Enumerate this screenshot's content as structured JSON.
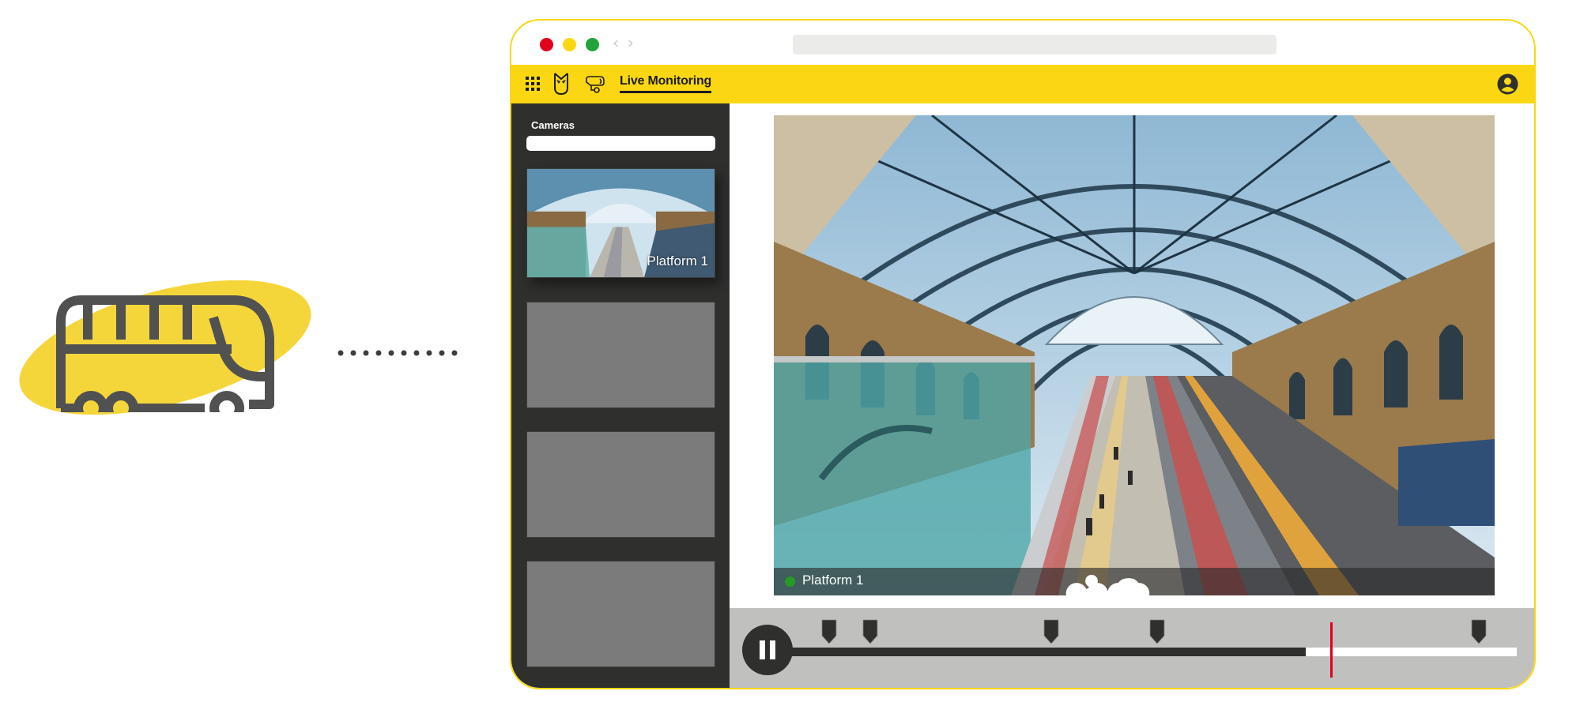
{
  "illustration": {
    "icon": "bus-icon",
    "connector": "dotted-line",
    "blob_color": "#f5d63a",
    "icon_color": "#515151"
  },
  "browser": {
    "traffic_lights": [
      "close",
      "minimize",
      "maximize"
    ],
    "nav_back": "‹",
    "nav_forward": "›",
    "address_bar_value": "",
    "frame_color": "#fbd713"
  },
  "appbar": {
    "apps_icon": "grid-icon",
    "logo_icon": "owl-icon",
    "section_icon": "security-camera-icon",
    "title": "Live Monitoring",
    "account_icon": "account-icon",
    "accent_color": "#fbd713"
  },
  "sidebar": {
    "label": "Cameras",
    "search_value": "",
    "cameras": [
      {
        "label": "Platform 1",
        "has_feed": true,
        "selected": true
      },
      {
        "label": "",
        "has_feed": false
      },
      {
        "label": "",
        "has_feed": false
      },
      {
        "label": "",
        "has_feed": false
      }
    ]
  },
  "video": {
    "camera_label": "Platform 1",
    "status": "live",
    "status_color": "#259a25",
    "status_icons": [
      "user-icon",
      "connection-dots-icon",
      "cloud-icon"
    ]
  },
  "timeline": {
    "state": "playing",
    "pause_label": "Pause",
    "progress_fraction": 0.712,
    "playhead_fraction": 0.746,
    "event_markers": [
      0.061,
      0.117,
      0.364,
      0.509,
      0.948
    ],
    "playhead_color": "#e3001b"
  }
}
